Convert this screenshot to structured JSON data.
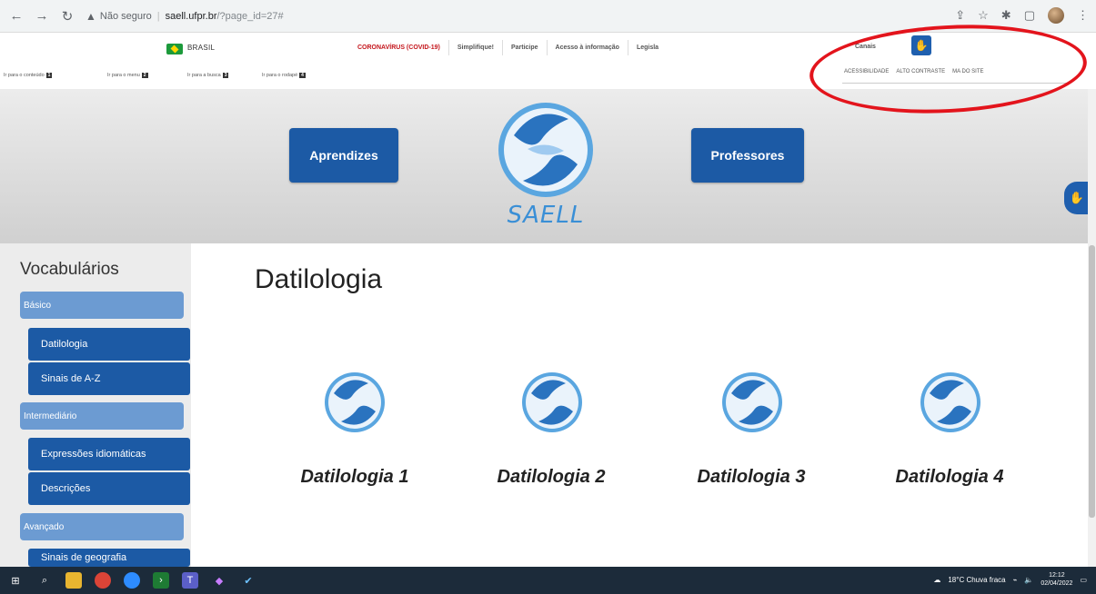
{
  "browser": {
    "security_label": "Não seguro",
    "url_host": "saell.ufpr.br",
    "url_path": "/?page_id=27#"
  },
  "govbar": {
    "brasil": "BRASIL",
    "links": [
      "CORONAVÍRUS (COVID-19)",
      "Simplifique!",
      "Participe",
      "Acesso à informação",
      "Legisla"
    ],
    "canais": "Canais"
  },
  "skip_links": [
    {
      "label": "Ir para o conteúdo",
      "key": "1"
    },
    {
      "label": "Ir para o menu",
      "key": "2"
    },
    {
      "label": "Ir para a busca",
      "key": "3"
    },
    {
      "label": "Ir para o rodapé",
      "key": "4"
    }
  ],
  "accessibility": {
    "acessibilidade": "ACESSIBILIDADE",
    "alto_contraste": "ALTO CONTRASTE",
    "mapa_site": "MA  DO SITE"
  },
  "banner": {
    "aprendizes": "Aprendizes",
    "professores": "Professores",
    "logo_text": "SAELL"
  },
  "sidebar": {
    "title": "Vocabulários",
    "basico": "Básico",
    "datilologia": "Datilologia",
    "sinais": "Sinais de A-Z",
    "intermediario": "Intermediário",
    "expressoes": "Expressões idiomáticas",
    "descricoes": "Descrições",
    "avancado": "Avançado",
    "sinais_geografia": "Sinais de geografia"
  },
  "main": {
    "title": "Datilologia",
    "cards": [
      "Datilologia 1",
      "Datilologia 2",
      "Datilologia 3",
      "Datilologia 4"
    ]
  },
  "taskbar": {
    "weather": "18°C  Chuva fraca",
    "time": "12:12",
    "date": "02/04/2022"
  },
  "colors": {
    "primary_blue": "#1c5aa5",
    "level_blue": "#6c9bd2",
    "annotation_red": "#e3141c"
  }
}
